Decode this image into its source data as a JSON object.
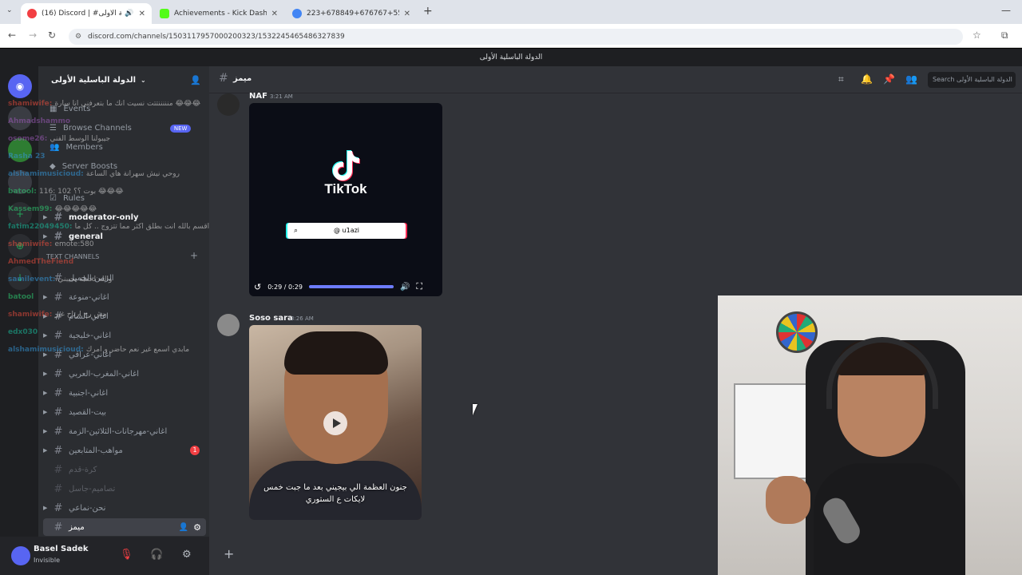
{
  "browser": {
    "tabs": [
      {
        "title": "(16) Discord | #الدولة الباسلية الأولى",
        "active": true,
        "favicon_color": "#f23f43"
      },
      {
        "title": "Achievements - Kick Dashboard",
        "active": false,
        "favicon_color": "#53fc18"
      },
      {
        "title": "223+678849+676767+555 - Go",
        "active": false,
        "favicon_color": "#4285f4"
      }
    ],
    "new_tab": "+",
    "url": "discord.com/channels/1503117957000200323/1532245465486327839"
  },
  "discord": {
    "window_title": "الدولة الباسلية الأولى",
    "guild_name": "الدولة الباسلية الأولى",
    "menu": [
      {
        "icon": "calendar-icon",
        "label": "Events"
      },
      {
        "icon": "browse-icon",
        "label": "Browse Channels",
        "badge": "NEW"
      },
      {
        "icon": "members-icon",
        "label": "Members"
      },
      {
        "icon": "boost-icon",
        "label": "Server Boosts"
      },
      {
        "icon": "rules-icon",
        "label": "Rules"
      }
    ],
    "channels": [
      {
        "name": "moderator-only",
        "bold": true,
        "caret": true
      },
      {
        "name": "general",
        "bold": true,
        "caret": true
      },
      {
        "name": "الزمن-الجميل",
        "bold": false,
        "caret": false
      },
      {
        "name": "اغاني-منوعة",
        "bold": false,
        "caret": true
      },
      {
        "name": "اغاني-الشام",
        "bold": false,
        "caret": true
      },
      {
        "name": "اغاني-خليجية",
        "bold": false,
        "caret": true
      },
      {
        "name": "اغاني-عراقي",
        "bold": false,
        "caret": true
      },
      {
        "name": "اغاني-المغرب-العربي",
        "bold": false,
        "caret": true
      },
      {
        "name": "اغاني-اجنبية",
        "bold": false,
        "caret": true
      },
      {
        "name": "بيت-القصيد",
        "bold": false,
        "caret": true
      },
      {
        "name": "اغاني-مهرجانات-الثلاثين-الزمة",
        "bold": false,
        "caret": true
      },
      {
        "name": "مواهب-المتابعين",
        "bold": false,
        "caret": true,
        "badge": "1"
      },
      {
        "name": "كرة-قدم",
        "muted": true,
        "caret": false
      },
      {
        "name": "تصاميم-جاسل",
        "muted": true,
        "caret": false
      },
      {
        "name": "نحن-نماعي",
        "bold": false,
        "caret": true
      },
      {
        "name": "ميمز",
        "active": true,
        "caret": false
      }
    ],
    "category_label": "TEXT CHANNELS",
    "add_channel": "+",
    "user": {
      "name": "Basel Sadek",
      "status": "Invisible"
    },
    "chat": {
      "channel_name": "ميمز",
      "search_placeholder": "Search الدولة الباسلية الأولى",
      "messages": [
        {
          "author": "NAF",
          "time": "3:21 AM",
          "video_brand": "TikTok",
          "video_handle": "@ u1azi",
          "video_time": "0:29 / 0:29",
          "progress": 1.0
        },
        {
          "author": "Soso sara",
          "time": "3:26 AM",
          "caption": "جنون العظمة الي بيجيني بعد ما جبت خمس لايكات ع الستوري"
        }
      ],
      "composer_plus": "+"
    },
    "stream_chat": [
      {
        "user": "shamiwife",
        "text": "منننننتتت نسيت انك ما بتعرفني انا سارة 😂😂😂",
        "color": "#e74c3c"
      },
      {
        "user": "Ahmadshammo",
        "text": "",
        "color": "#9b59b6"
      },
      {
        "user": "osome26",
        "text": "جيبولنا الوسط الفني",
        "color": "#9b59b6"
      },
      {
        "user": "Rasha 23",
        "text": "",
        "color": "#3498db"
      },
      {
        "user": "alshamimusicioud",
        "text": "روحي نيش سهرانة هاي الساعة",
        "color": "#3498db"
      },
      {
        "user": "batool",
        "text": "116: 102 بوت ؟؟ 😂😂😂",
        "color": "#2ecc71"
      },
      {
        "user": "Kassem99",
        "text": "😂😂😂😂😂",
        "color": "#2ecc71"
      },
      {
        "user": "fatim22049450",
        "text": "اقسم بالله انت بطلق اكثر مما تتزوج .. كل ما",
        "color": "#1abc9c"
      },
      {
        "user": "shamiwife",
        "text": "emote:580",
        "color": "#e74c3c"
      },
      {
        "user": "AhmedTheFiend",
        "text": "",
        "color": "#e74c3c"
      },
      {
        "user": "samilevent",
        "text": "والله لحظة يجيبني",
        "color": "#3498db"
      },
      {
        "user": "batool",
        "text": "",
        "color": "#2ecc71"
      },
      {
        "user": "shamiwife",
        "text": "مش رح ارتاح غير",
        "color": "#e74c3c"
      },
      {
        "user": "edx030",
        "text": "",
        "color": "#1abc9c"
      },
      {
        "user": "alshamimusicioud",
        "text": "مابدي اسمع غير نعم حاضر و امرك",
        "color": "#3498db"
      }
    ]
  },
  "colors": {
    "discord_bg": "#313338",
    "sidebar_bg": "#2b2d31",
    "rail_bg": "#1e1f22",
    "accent": "#5865f2",
    "danger": "#f23f43"
  }
}
